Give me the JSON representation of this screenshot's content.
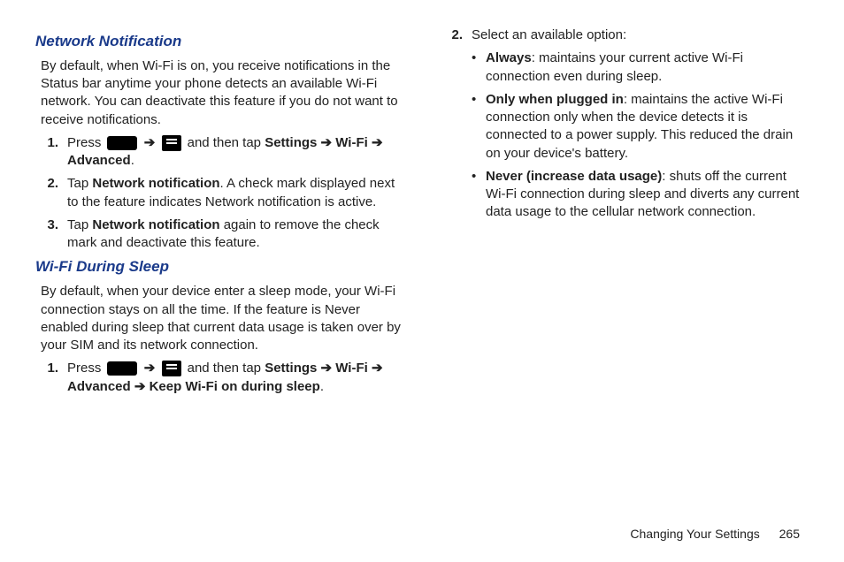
{
  "left": {
    "h1": "Network Notification",
    "p1": "By default, when Wi-Fi is on, you receive notifications in the Status bar anytime your phone detects an available Wi-Fi network. You can deactivate this feature if you do not want to receive notifications.",
    "s1_nn": {
      "n1": "1.",
      "i1a": "Press ",
      "i1b": " and then tap ",
      "i1c": "Settings ➔ Wi-Fi ➔ Advanced",
      "i1d": ".",
      "n2": "2.",
      "i2a": "Tap ",
      "i2b": "Network notification",
      "i2c": ". A check mark displayed next to the feature indicates Network notification is active.",
      "n3": "3.",
      "i3a": "Tap ",
      "i3b": "Network notification",
      "i3c": " again to remove the check mark and deactivate this feature."
    },
    "h2": "Wi-Fi During Sleep",
    "p2": "By default, when your device enter a sleep mode, your Wi-Fi connection stays on all the time. If the feature is Never enabled during sleep that current data usage is taken over by your SIM and its network connection.",
    "s2_ws": {
      "n1": "1.",
      "i1a": "Press ",
      "i1b": " and then tap ",
      "i1c": "Settings ➔ Wi-Fi ➔ Advanced ➔ Keep Wi-Fi on during sleep",
      "i1d": "."
    }
  },
  "right": {
    "n2": "2.",
    "i2": "Select an available option:",
    "opts": {
      "a_b": "Always",
      "a_t": ": maintains your current active Wi-Fi connection even during sleep.",
      "b_b": "Only when plugged in",
      "b_t": ": maintains the active Wi-Fi connection only when the device detects it is connected to a power supply. This reduced the drain on your device's battery.",
      "c_b": "Never (increase data usage)",
      "c_t": ": shuts off the current Wi-Fi connection during sleep and diverts any current data usage to the cellular network connection."
    }
  },
  "footer": {
    "section": "Changing Your Settings",
    "page": "265"
  },
  "arrow": "➔"
}
